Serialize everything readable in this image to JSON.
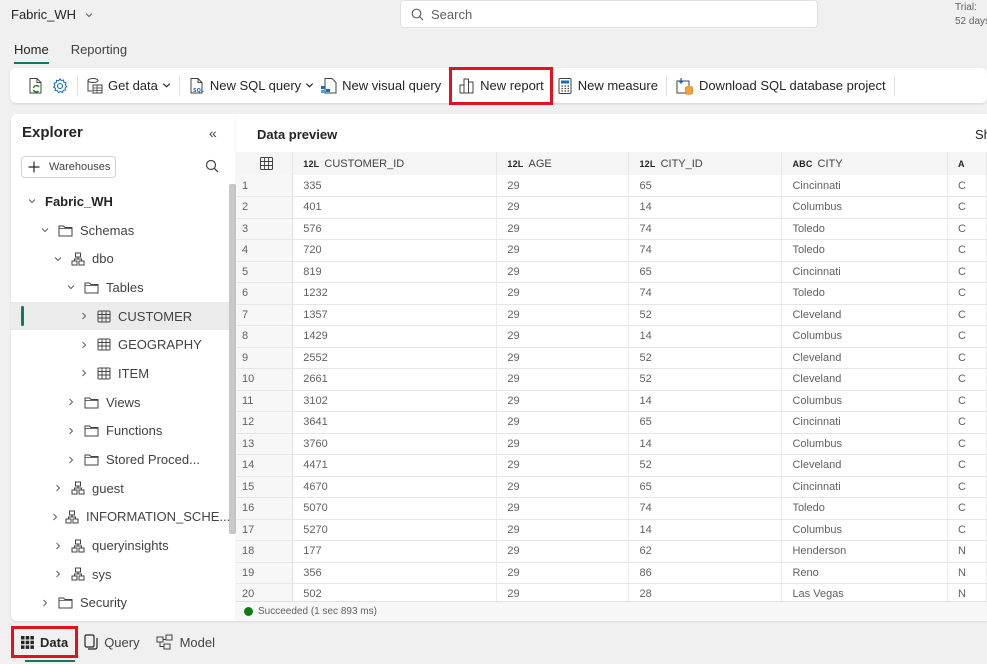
{
  "topbar": {
    "workspace_name": "Fabric_WH",
    "search_placeholder": "Search",
    "trial_line1": "Trial:",
    "trial_line2": "52 days"
  },
  "ribbon": {
    "tabs": [
      {
        "label": "Home",
        "active": true
      },
      {
        "label": "Reporting",
        "active": false
      }
    ],
    "toolbar": {
      "get_data": "Get data",
      "new_sql_query": "New SQL query",
      "new_visual_query": "New visual query",
      "new_report": "New report",
      "new_measure": "New measure",
      "download_project": "Download SQL database project"
    }
  },
  "explorer": {
    "title": "Explorer",
    "add_button": "Warehouses",
    "tree": [
      {
        "label": "Fabric_WH",
        "level": 0,
        "expanded": true,
        "icon": "none",
        "bold": true
      },
      {
        "label": "Schemas",
        "level": 1,
        "expanded": true,
        "icon": "folder"
      },
      {
        "label": "dbo",
        "level": 2,
        "expanded": true,
        "icon": "schema"
      },
      {
        "label": "Tables",
        "level": 3,
        "expanded": true,
        "icon": "folder"
      },
      {
        "label": "CUSTOMER",
        "level": 4,
        "expanded": false,
        "icon": "table",
        "selected": true
      },
      {
        "label": "GEOGRAPHY",
        "level": 4,
        "expanded": false,
        "icon": "table"
      },
      {
        "label": "ITEM",
        "level": 4,
        "expanded": false,
        "icon": "table"
      },
      {
        "label": "Views",
        "level": 3,
        "expanded": false,
        "icon": "folder"
      },
      {
        "label": "Functions",
        "level": 3,
        "expanded": false,
        "icon": "folder"
      },
      {
        "label": "Stored Proced...",
        "level": 3,
        "expanded": false,
        "icon": "folder"
      },
      {
        "label": "guest",
        "level": 2,
        "expanded": false,
        "icon": "schema"
      },
      {
        "label": "INFORMATION_SCHE...",
        "level": 2,
        "expanded": false,
        "icon": "schema"
      },
      {
        "label": "queryinsights",
        "level": 2,
        "expanded": false,
        "icon": "schema"
      },
      {
        "label": "sys",
        "level": 2,
        "expanded": false,
        "icon": "schema"
      },
      {
        "label": "Security",
        "level": 1,
        "expanded": false,
        "icon": "folder"
      }
    ]
  },
  "preview": {
    "title": "Data preview",
    "show_label": "Sh",
    "columns": [
      {
        "type": "12L",
        "name": "CUSTOMER_ID"
      },
      {
        "type": "12L",
        "name": "AGE"
      },
      {
        "type": "12L",
        "name": "CITY_ID"
      },
      {
        "type": "ABC",
        "name": "CITY"
      },
      {
        "type": "A",
        "name": ""
      }
    ],
    "rows": [
      [
        "1",
        "335",
        "29",
        "65",
        "Cincinnati",
        "C"
      ],
      [
        "2",
        "401",
        "29",
        "14",
        "Columbus",
        "C"
      ],
      [
        "3",
        "576",
        "29",
        "74",
        "Toledo",
        "C"
      ],
      [
        "4",
        "720",
        "29",
        "74",
        "Toledo",
        "C"
      ],
      [
        "5",
        "819",
        "29",
        "65",
        "Cincinnati",
        "C"
      ],
      [
        "6",
        "1232",
        "29",
        "74",
        "Toledo",
        "C"
      ],
      [
        "7",
        "1357",
        "29",
        "52",
        "Cleveland",
        "C"
      ],
      [
        "8",
        "1429",
        "29",
        "14",
        "Columbus",
        "C"
      ],
      [
        "9",
        "2552",
        "29",
        "52",
        "Cleveland",
        "C"
      ],
      [
        "10",
        "2661",
        "29",
        "52",
        "Cleveland",
        "C"
      ],
      [
        "11",
        "3102",
        "29",
        "14",
        "Columbus",
        "C"
      ],
      [
        "12",
        "3641",
        "29",
        "65",
        "Cincinnati",
        "C"
      ],
      [
        "13",
        "3760",
        "29",
        "14",
        "Columbus",
        "C"
      ],
      [
        "14",
        "4471",
        "29",
        "52",
        "Cleveland",
        "C"
      ],
      [
        "15",
        "4670",
        "29",
        "65",
        "Cincinnati",
        "C"
      ],
      [
        "16",
        "5070",
        "29",
        "74",
        "Toledo",
        "C"
      ],
      [
        "17",
        "5270",
        "29",
        "14",
        "Columbus",
        "C"
      ],
      [
        "18",
        "177",
        "29",
        "62",
        "Henderson",
        "N"
      ],
      [
        "19",
        "356",
        "29",
        "86",
        "Reno",
        "N"
      ],
      [
        "20",
        "502",
        "29",
        "28",
        "Las Vegas",
        "N"
      ]
    ],
    "status": "Succeeded (1 sec 893 ms)"
  },
  "bottom_tabs": [
    {
      "label": "Data",
      "active": true,
      "icon": "grid"
    },
    {
      "label": "Query",
      "active": false,
      "icon": "document"
    },
    {
      "label": "Model",
      "active": false,
      "icon": "model"
    }
  ],
  "colors": {
    "accent": "#117865",
    "highlight": "#e0141e",
    "success": "#107c10"
  }
}
